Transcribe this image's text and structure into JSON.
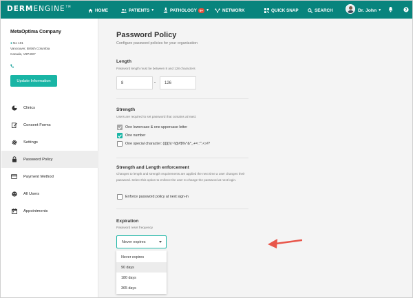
{
  "navbar": {
    "logo_bold": "DERM",
    "logo_light": "ENGINE",
    "logo_tm": "TM",
    "items": [
      {
        "label": "HOME",
        "icon": "home-icon"
      },
      {
        "label": "PATIENTS",
        "icon": "patients-icon",
        "caret": "▼"
      },
      {
        "label": "PATHOLOGY",
        "icon": "pathology-icon",
        "badge": "9+",
        "caret": "▼"
      },
      {
        "label": "NETWORK",
        "icon": "network-icon"
      },
      {
        "label": "QUICK SNAP",
        "icon": "qr-code-icon"
      },
      {
        "label": "SEARCH",
        "icon": "search-icon"
      }
    ],
    "user": {
      "name": "Dr. John",
      "caret": "▼"
    },
    "bar_color": "#08847d"
  },
  "sidebar": {
    "company": "MetaOptima Company",
    "address": [
      "No 101",
      "Vancouver, British Columbia",
      "Canada, V6P4W7"
    ],
    "update_button": "Update Information",
    "menu": [
      {
        "label": "Clinics",
        "icon": "pie-chart-icon"
      },
      {
        "label": "Consent Forms",
        "icon": "edit-form-icon"
      },
      {
        "label": "Settings",
        "icon": "gear-icon"
      },
      {
        "label": "Password Policy",
        "icon": "lock-icon",
        "active": true
      },
      {
        "label": "Payment Method",
        "icon": "credit-card-icon"
      },
      {
        "label": "All Users",
        "icon": "users-icon"
      },
      {
        "label": "Appointments",
        "icon": "calendar-icon"
      }
    ],
    "accent": "#19b5a5"
  },
  "main": {
    "title": "Password Policy",
    "subtitle": "Configure password policies for your organization",
    "length": {
      "title": "Length",
      "desc": "Password length must be between 8 and 128 characters",
      "min": "8",
      "max": "126"
    },
    "strength": {
      "title": "Strength",
      "desc": "Users are required to set password that contains at least:",
      "options": [
        {
          "label": "One lowercase & one uppercase letter",
          "checked": true,
          "style": "grey"
        },
        {
          "label": "One number",
          "checked": true,
          "style": "teal"
        },
        {
          "label": "One special character: ()[]{}\\|~!@#$%^&*_+=;:'\",<>/?",
          "checked": false
        }
      ]
    },
    "enforcement": {
      "title": "Strength and Length enforcement",
      "desc": "Changes to length and strength requirements are applied the next time a user changes their password. Select this option to enforce the user to change the password at next login.",
      "option": "Enforce password policy at next sign-in"
    },
    "expiration": {
      "title": "Expiration",
      "desc": "Password reset frequency",
      "selected": "Never expires",
      "options": [
        "Never expires",
        "90 days",
        "180 days",
        "365 days"
      ],
      "hovered_index": 1
    },
    "annotation_color": "#e8564a"
  }
}
